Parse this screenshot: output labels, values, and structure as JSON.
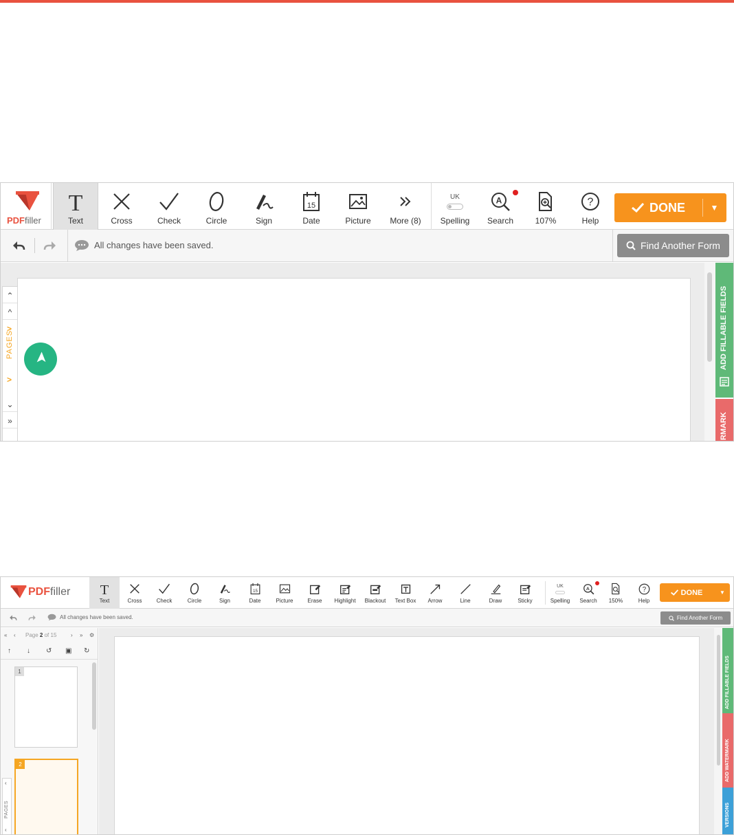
{
  "brand": {
    "pdf": "PDF",
    "filler": "filler",
    "accent": "#e9523f",
    "done_color": "#f7931d"
  },
  "screen1": {
    "tools": [
      {
        "label": "Text",
        "icon": "text-icon",
        "active": true
      },
      {
        "label": "Cross",
        "icon": "cross-icon"
      },
      {
        "label": "Check",
        "icon": "check-icon"
      },
      {
        "label": "Circle",
        "icon": "circle-icon"
      },
      {
        "label": "Sign",
        "icon": "sign-icon"
      },
      {
        "label": "Date",
        "icon": "date-icon",
        "glyph": "15"
      },
      {
        "label": "Picture",
        "icon": "picture-icon"
      },
      {
        "label": "More (8)",
        "icon": "more-icon"
      }
    ],
    "spelling": {
      "label": "Spelling",
      "lang": "UK"
    },
    "search_label": "Search",
    "zoom_label": "107%",
    "help_label": "Help",
    "done_label": "DONE",
    "status": "All changes have been saved.",
    "find_label": "Find Another Form",
    "pages_label": "PAGES",
    "side_tabs": {
      "fillable": "ADD FILLABLE FIELDS",
      "watermark": "RMARK"
    }
  },
  "screen2": {
    "tools": [
      {
        "label": "Text",
        "icon": "text-icon",
        "active": true
      },
      {
        "label": "Cross",
        "icon": "cross-icon"
      },
      {
        "label": "Check",
        "icon": "check-icon"
      },
      {
        "label": "Circle",
        "icon": "circle-icon"
      },
      {
        "label": "Sign",
        "icon": "sign-icon"
      },
      {
        "label": "Date",
        "icon": "date-icon",
        "glyph": "15"
      },
      {
        "label": "Picture",
        "icon": "picture-icon"
      },
      {
        "label": "Erase",
        "icon": "erase-icon"
      },
      {
        "label": "Highlight",
        "icon": "highlight-icon"
      },
      {
        "label": "Blackout",
        "icon": "blackout-icon"
      },
      {
        "label": "Text Box",
        "icon": "text-box-icon"
      },
      {
        "label": "Arrow",
        "icon": "arrow-icon"
      },
      {
        "label": "Line",
        "icon": "line-icon"
      },
      {
        "label": "Draw",
        "icon": "draw-icon"
      },
      {
        "label": "Sticky",
        "icon": "sticky-icon"
      }
    ],
    "spelling": {
      "label": "Spelling",
      "lang": "UK"
    },
    "search_label": "Search",
    "zoom_label": "150%",
    "help_label": "Help",
    "done_label": "DONE",
    "status": "All changes have been saved.",
    "find_label": "Find Another Form",
    "pager": {
      "prefix": "Page",
      "current": "2",
      "suffix": "of 15"
    },
    "thumbs": [
      "1",
      "2"
    ],
    "pages_label": "PAGES",
    "side_tabs": {
      "fillable": "ADD FILLABLE FIELDS",
      "watermark": "ADD WATERMARK",
      "versions": "VERSIONS"
    }
  }
}
